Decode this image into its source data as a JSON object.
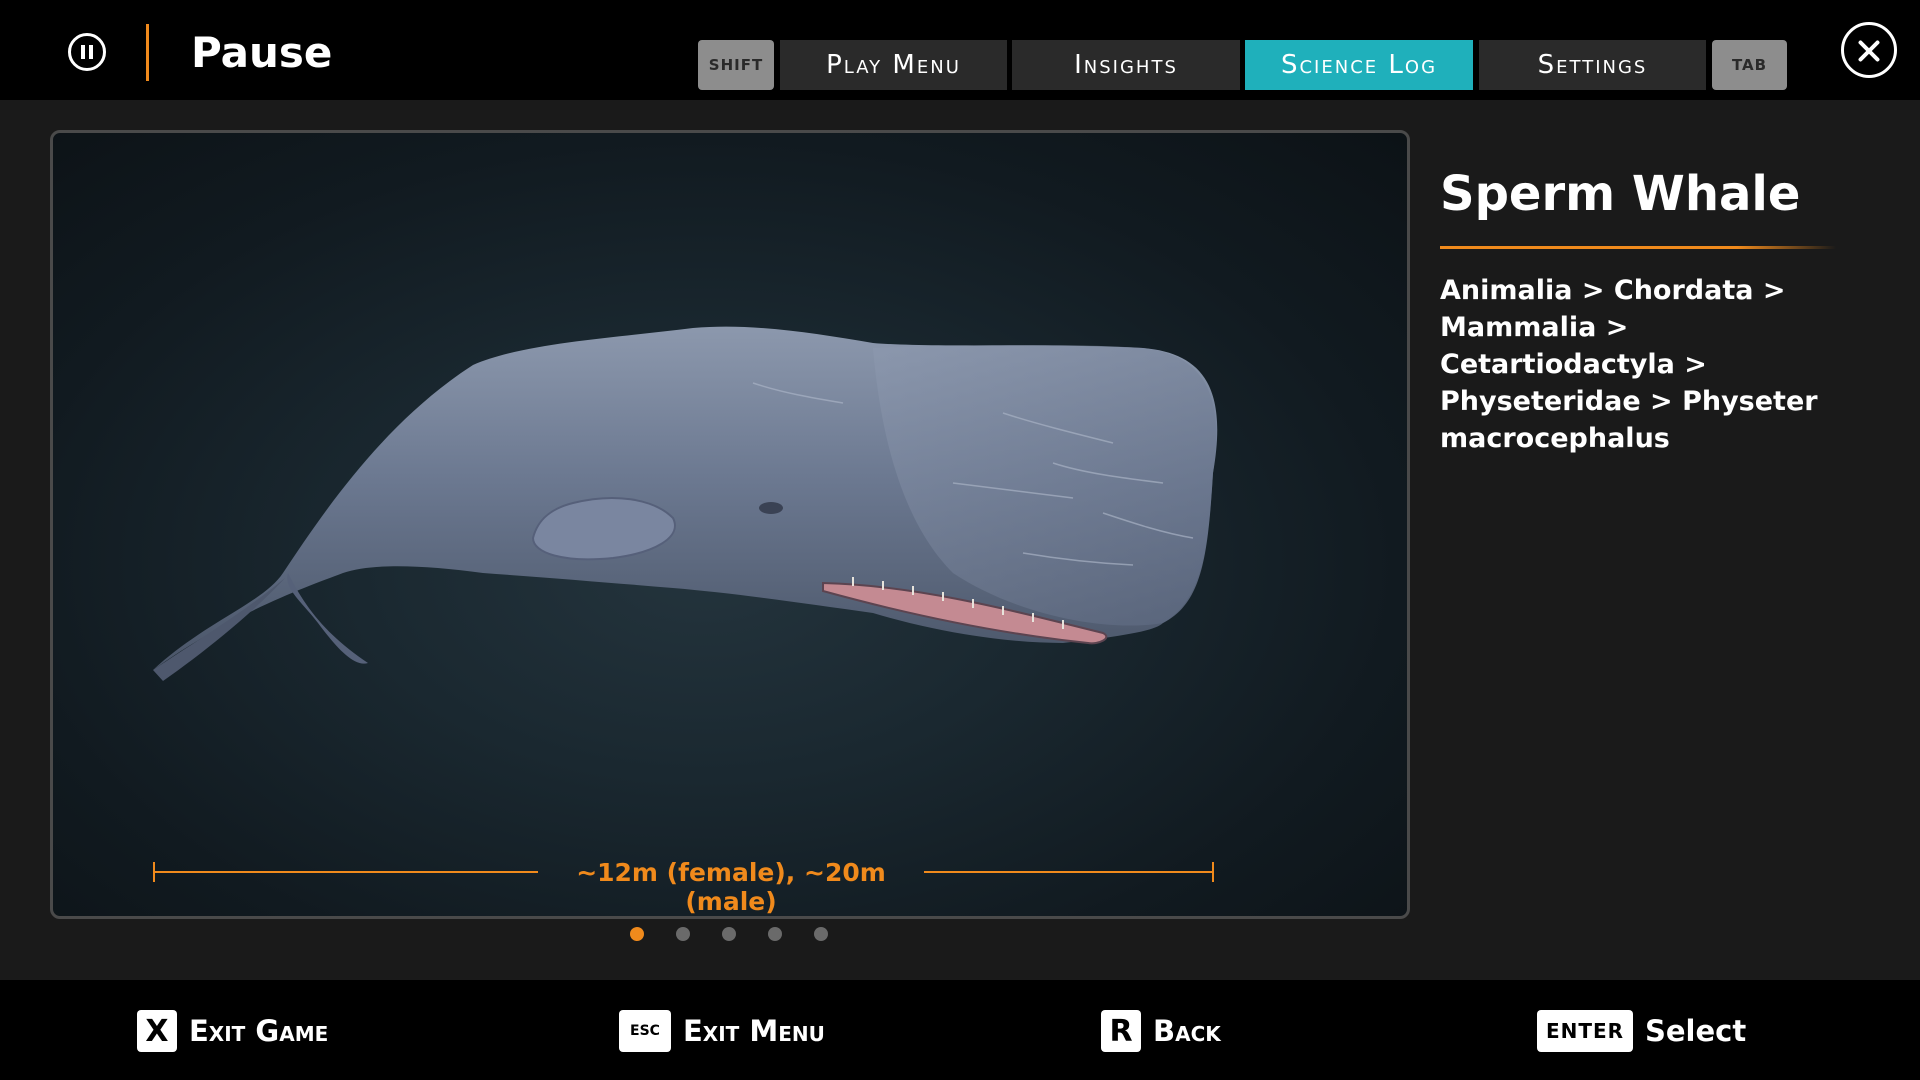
{
  "header": {
    "title": "Pause",
    "shift_key": "SHIFT",
    "tab_key": "TAB",
    "tabs": [
      {
        "label": "Play Menu",
        "active": false
      },
      {
        "label": "Insights",
        "active": false
      },
      {
        "label": "Science Log",
        "active": true
      },
      {
        "label": "Settings",
        "active": false
      }
    ]
  },
  "icons": {
    "pause": "pause-icon",
    "close": "close-icon"
  },
  "entry": {
    "name": "Sperm Whale",
    "taxonomy": "Animalia > Chordata > Mammalia > Cetartiodactyla > Physeteridae > Physeter macrocephalus",
    "size_label": "~12m (female), ~20m (male)",
    "image": "sperm-whale-illustration",
    "page_count": 5,
    "current_page": 1
  },
  "footer": {
    "actions": [
      {
        "key": "X",
        "label": "Exit Game"
      },
      {
        "key": "ESC",
        "label": "Exit Menu"
      },
      {
        "key": "R",
        "label": "Back"
      },
      {
        "key": "ENTER",
        "label": "Select"
      }
    ]
  },
  "colors": {
    "accent_orange": "#f08a1c",
    "active_tab": "#1fb0bb",
    "tab_bg": "#2a2a2a",
    "key_bg": "#8d8d8d",
    "bar_bg": "#000000",
    "body_bg": "#1a1a1a"
  }
}
